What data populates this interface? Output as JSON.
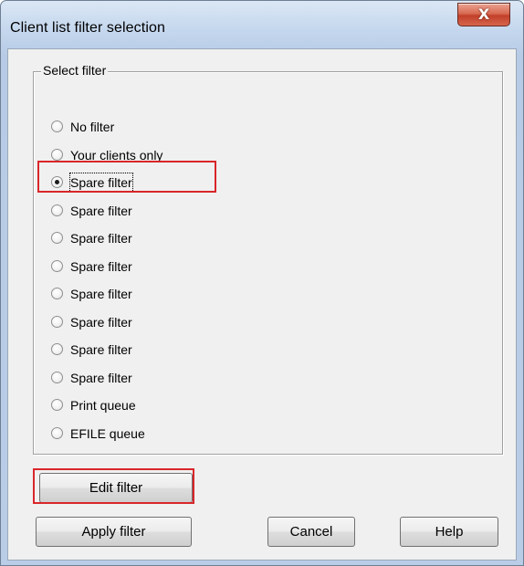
{
  "window": {
    "title": "Client list filter selection",
    "close_glyph": "X"
  },
  "group": {
    "label": "Select filter",
    "options": [
      {
        "label": "No filter",
        "checked": false
      },
      {
        "label": "Your clients only",
        "checked": false
      },
      {
        "label": "Spare filter",
        "checked": true
      },
      {
        "label": "Spare filter",
        "checked": false
      },
      {
        "label": "Spare filter",
        "checked": false
      },
      {
        "label": "Spare filter",
        "checked": false
      },
      {
        "label": "Spare filter",
        "checked": false
      },
      {
        "label": "Spare filter",
        "checked": false
      },
      {
        "label": "Spare filter",
        "checked": false
      },
      {
        "label": "Spare filter",
        "checked": false
      },
      {
        "label": "Print queue",
        "checked": false
      },
      {
        "label": "EFILE queue",
        "checked": false
      }
    ]
  },
  "buttons": {
    "edit": "Edit filter",
    "apply": "Apply filter",
    "cancel": "Cancel",
    "help": "Help"
  },
  "colors": {
    "highlight": "#d9262a"
  }
}
